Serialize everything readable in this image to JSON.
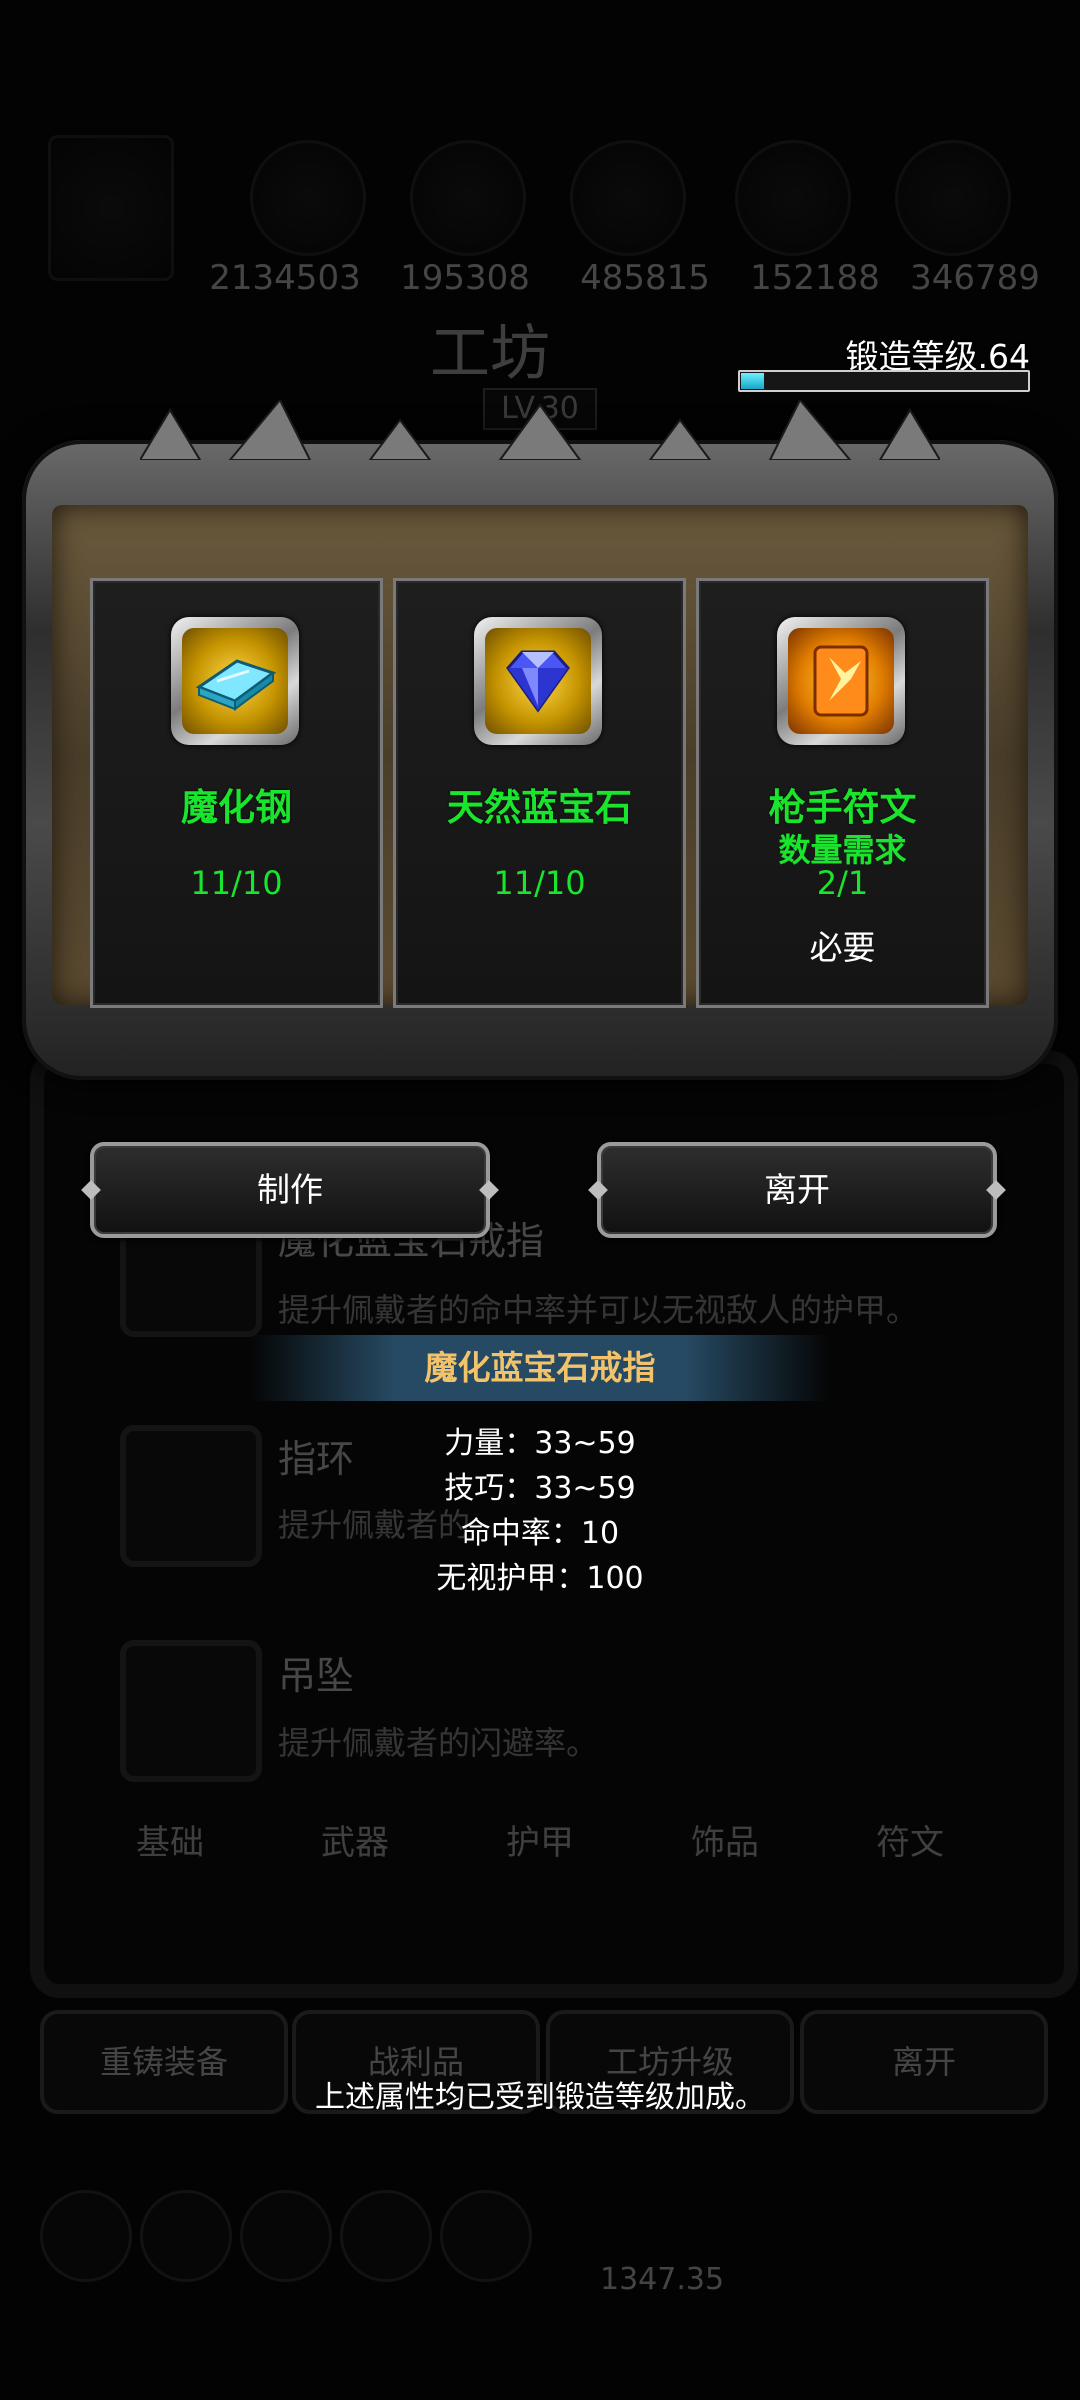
{
  "background": {
    "resource_values": [
      "2134503",
      "195308",
      "485815",
      "152188",
      "346789"
    ],
    "workshop_title": "工坊",
    "workshop_level": "LV.30",
    "items": [
      {
        "name": "魔化蓝宝石戒指",
        "desc": "提升佩戴者的命中率并可以无视敌人的护甲。"
      },
      {
        "name": "指环",
        "desc": "提升佩戴者的"
      },
      {
        "name": "吊坠",
        "desc": "提升佩戴者的闪避率。"
      }
    ],
    "tabs": [
      "基础",
      "武器",
      "护甲",
      "饰品",
      "符文"
    ],
    "buttons": [
      "重铸装备",
      "战利品",
      "工坊升级",
      "离开"
    ],
    "bottom_counter": "1347.35"
  },
  "forge": {
    "level_label": "锻造等级.64",
    "progress": 0.08
  },
  "materials": [
    {
      "name": "魔化钢",
      "sub": "",
      "count": "11/10",
      "required": "",
      "icon": "steel-ingot-icon"
    },
    {
      "name": "天然蓝宝石",
      "sub": "",
      "count": "11/10",
      "required": "",
      "icon": "sapphire-gem-icon"
    },
    {
      "name": "枪手符文",
      "sub": "数量需求",
      "count": "2/1",
      "required": "必要",
      "icon": "rune-scroll-icon"
    }
  ],
  "actions": {
    "make_label": "制作",
    "leave_label": "离开"
  },
  "tooltip": {
    "title": "魔化蓝宝石戒指",
    "stats": [
      "力量：33~59",
      "技巧：33~59",
      "命中率：10",
      "无视护甲：100"
    ],
    "footnote": "上述属性均已受到锻造等级加成。"
  },
  "colors": {
    "material_green": "#19e52c",
    "title_gold": "#f2c36a",
    "progress_cyan": "#15a6c6"
  }
}
